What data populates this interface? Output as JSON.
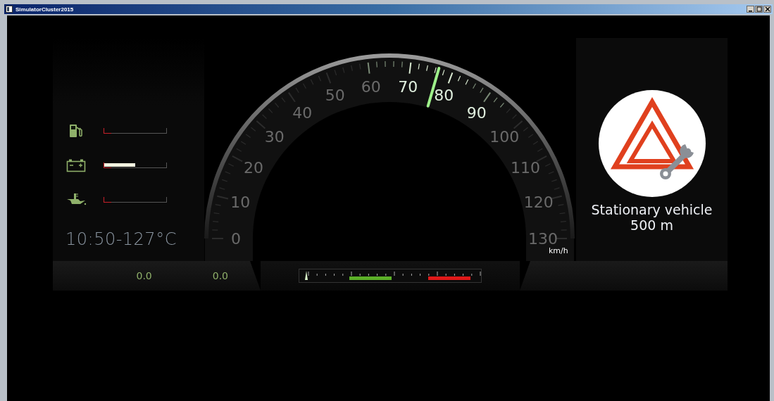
{
  "window": {
    "title": "SimulatorCluster2015"
  },
  "gauges": [
    {
      "kind": "fuel",
      "level": 0
    },
    {
      "kind": "battery",
      "level": 0.5
    },
    {
      "kind": "oil",
      "level": 0
    }
  ],
  "readout": "10:50-127°C",
  "speedometer": {
    "labels": [
      "0",
      "10",
      "20",
      "30",
      "40",
      "50",
      "60",
      "70",
      "80",
      "90",
      "100",
      "110",
      "120",
      "130"
    ],
    "unit": "km/h",
    "level": 0.59
  },
  "bottom_values": [
    "0.0",
    "0.0"
  ],
  "range_bar": {
    "level": 0.02
  },
  "warning": {
    "message": "Stationary vehicle",
    "distance": "500 m"
  }
}
